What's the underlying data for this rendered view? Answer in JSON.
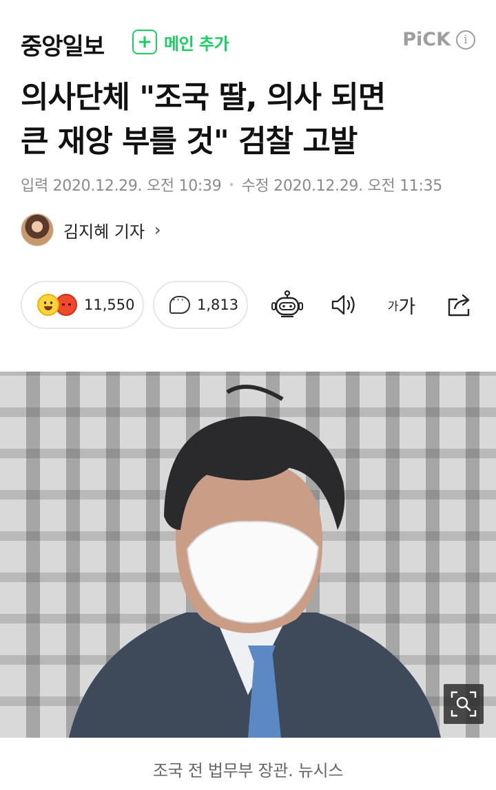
{
  "header": {
    "press_name": "중앙일보",
    "add_main_label": "메인 추가",
    "pick_label": "PiCK",
    "info_symbol": "i"
  },
  "article": {
    "title_line1": "의사단체 \"조국 딸, 의사 되면",
    "title_line2": "큰 재앙 부를 것\" 검찰 고발",
    "input_label": "입력",
    "input_date": "2020.12.29. 오전 10:39",
    "modified_label": "수정",
    "modified_date": "2020.12.29. 오전 11:35",
    "reporter": "김지혜 기자",
    "reporter_chevron": "›"
  },
  "actions": {
    "reaction_count": "11,550",
    "comment_count": "1,813",
    "font_small": "가",
    "font_large": "가"
  },
  "photo": {
    "caption": "조국 전 법무부 장관. 뉴시스"
  },
  "colors": {
    "accent_green": "#19ce60",
    "muted_gray": "#8a8a8a"
  },
  "icons": [
    "plus-icon",
    "info-icon",
    "chevron-right-icon",
    "smile-emoji-icon",
    "angry-emoji-icon",
    "comment-icon",
    "robot-icon",
    "speaker-icon",
    "font-size-icon",
    "share-icon",
    "zoom-icon"
  ]
}
